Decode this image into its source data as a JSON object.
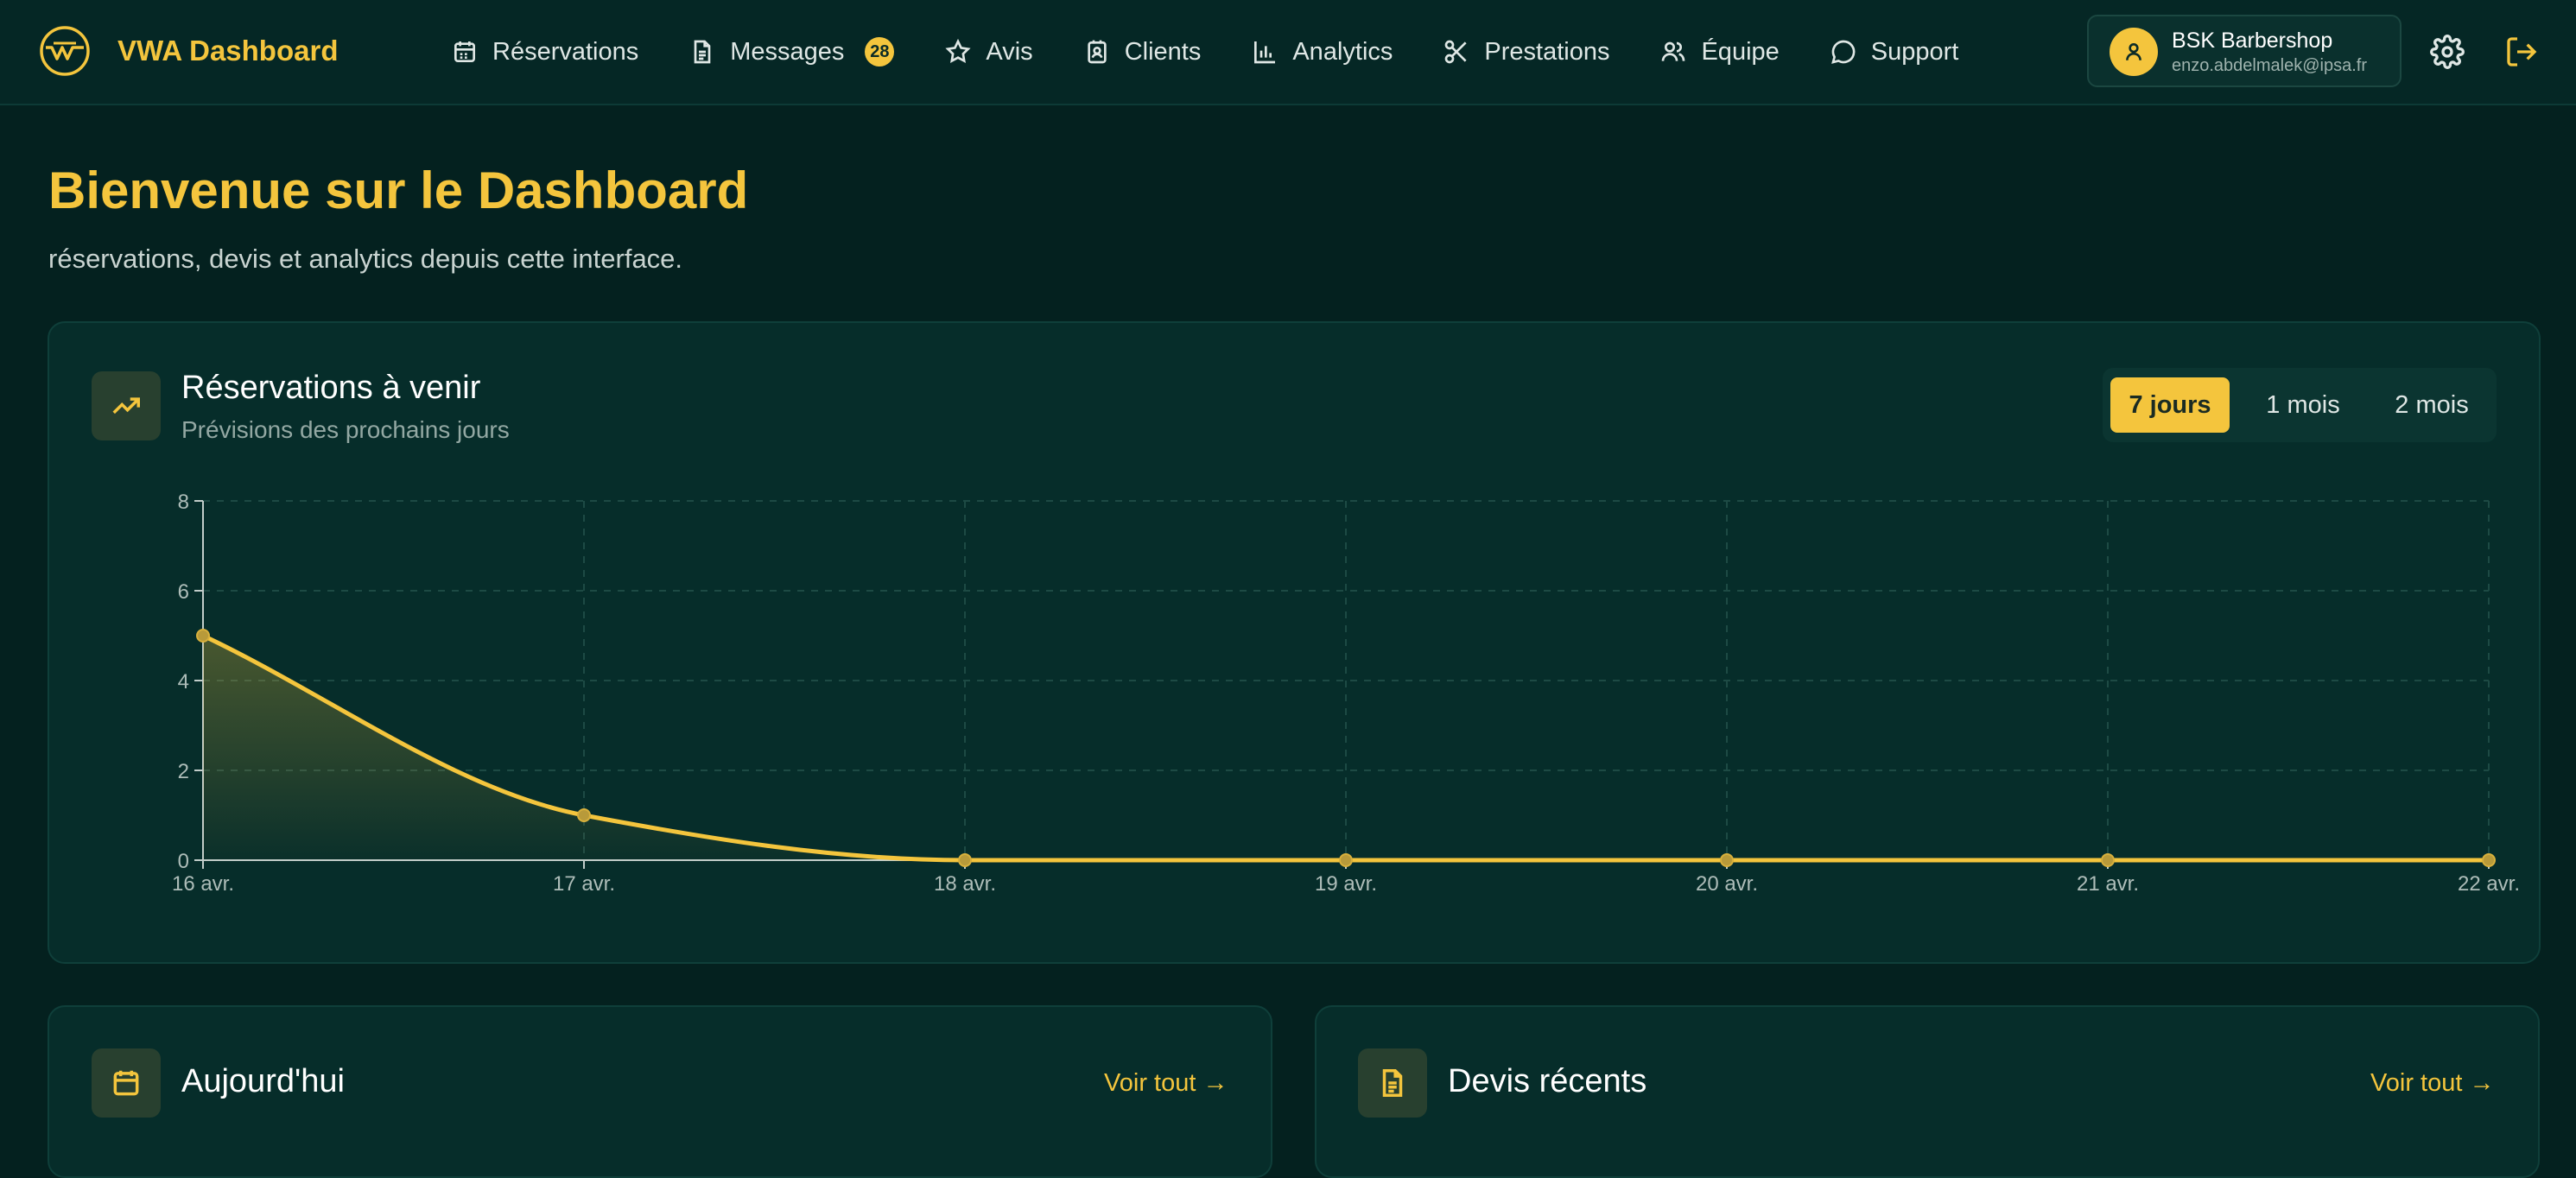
{
  "app": {
    "name": "VWA Dashboard"
  },
  "nav": {
    "items": [
      {
        "label": "Réservations",
        "icon": "calendar-icon"
      },
      {
        "label": "Messages",
        "icon": "document-icon",
        "badge": "28"
      },
      {
        "label": "Avis",
        "icon": "star-icon"
      },
      {
        "label": "Clients",
        "icon": "contact-icon"
      },
      {
        "label": "Analytics",
        "icon": "bar-chart-icon"
      },
      {
        "label": "Prestations",
        "icon": "scissors-icon"
      },
      {
        "label": "Équipe",
        "icon": "users-icon"
      },
      {
        "label": "Support",
        "icon": "chat-bubble-icon"
      }
    ]
  },
  "user": {
    "name": "BSK Barbershop",
    "email": "enzo.abdelmalek@ipsa.fr"
  },
  "header": {
    "title": "Bienvenue sur le Dashboard",
    "subtitle": "réservations, devis et analytics depuis cette interface."
  },
  "reservations_card": {
    "title": "Réservations à venir",
    "subtitle": "Prévisions des prochains jours",
    "ranges": [
      "7 jours",
      "1 mois",
      "2 mois"
    ],
    "selected_range": "7 jours"
  },
  "chart_data": {
    "type": "area",
    "x": [
      "16 avr.",
      "17 avr.",
      "18 avr.",
      "19 avr.",
      "20 avr.",
      "21 avr.",
      "22 avr."
    ],
    "series": [
      {
        "values": [
          5,
          1,
          0,
          0,
          0,
          0,
          0
        ]
      }
    ],
    "ylim": [
      0,
      8
    ],
    "yticks": [
      0,
      2,
      4,
      6,
      8
    ],
    "grid": true,
    "line_color": "#f4c53d"
  },
  "today_card": {
    "title": "Aujourd'hui",
    "link": "Voir tout →"
  },
  "quotes_card": {
    "title": "Devis récents",
    "link": "Voir tout →"
  },
  "colors": {
    "accent": "#f4c53d",
    "background": "#04211f",
    "card": "#062d2a"
  }
}
